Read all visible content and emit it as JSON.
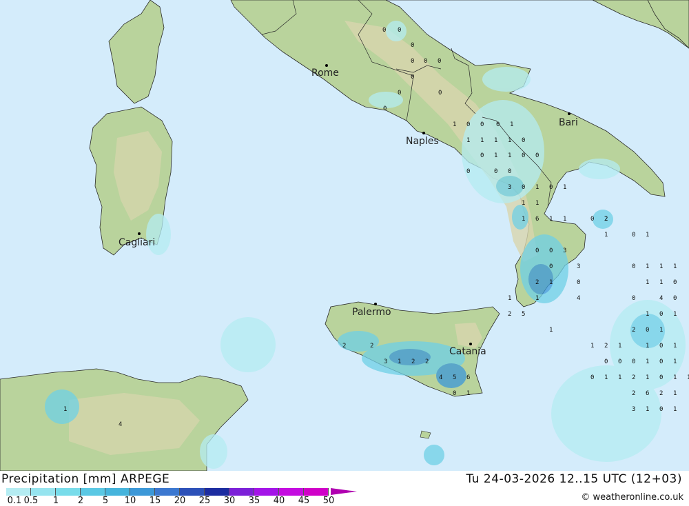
{
  "map": {
    "colors": {
      "sea": "#d4ecfb",
      "land_low": "#b9d39c",
      "land_high": "#d8d6ae",
      "precip_light": "#b4ecf2",
      "precip_mid": "#6fd0e6",
      "precip_heavy": "#3c98d8"
    },
    "cities": [
      {
        "name": "Rome"
      },
      {
        "name": "Naples"
      },
      {
        "name": "Bari"
      },
      {
        "name": "Cagliari"
      },
      {
        "name": "Palermo"
      },
      {
        "name": "Catania"
      }
    ],
    "values": [
      "0",
      "0",
      "0",
      "0",
      "0",
      "0",
      "0",
      "0",
      "0",
      "0",
      "1",
      "0",
      "0",
      "0",
      "1",
      "1",
      "1",
      "1",
      "1",
      "0",
      "0",
      "1",
      "1",
      "0",
      "0",
      "0",
      "0",
      "0",
      "3",
      "0",
      "1",
      "0",
      "1",
      "1",
      "1",
      "1",
      "6",
      "1",
      "1",
      "0",
      "2",
      "0",
      "0",
      "0",
      "3",
      "2",
      "1",
      "0",
      "3",
      "4",
      "1",
      "1",
      "2",
      "5",
      "1",
      "0",
      "1",
      "1",
      "0",
      "1",
      "0",
      "1",
      "0",
      "1",
      "1",
      "4",
      "2",
      "2",
      "3",
      "1",
      "2",
      "2",
      "4",
      "5",
      "6",
      "0",
      "1",
      "2",
      "6",
      "2",
      "1",
      "3",
      "1",
      "0",
      "1",
      "2",
      "1",
      "0",
      "1",
      "0",
      "1",
      "2",
      "1",
      "4",
      "0",
      "0",
      "1",
      "1",
      "0",
      "0",
      "1",
      "1",
      "1",
      "1",
      "2",
      "1",
      "0",
      "0",
      "0",
      "1",
      "1",
      "2",
      "1",
      "0",
      "1",
      "1"
    ]
  },
  "footer": {
    "title": "Precipitation [mm] ARPEGE",
    "run_time": "Tu 24-03-2026 12..15 UTC (12+03)",
    "credit": "© weatheronline.co.uk",
    "legend": {
      "labels": [
        "0.1",
        "0.5",
        "1",
        "2",
        "5",
        "10",
        "15",
        "20",
        "25",
        "30",
        "35",
        "40",
        "45",
        "50"
      ],
      "colors": [
        "#b4ecf2",
        "#96e4ef",
        "#78dcea",
        "#5ac8e4",
        "#46b4dc",
        "#3c98d8",
        "#3c78d0",
        "#2c50b8",
        "#1c2ca0",
        "#7c20d8",
        "#a414e8",
        "#c40ce0",
        "#d000c8",
        "#b000b0"
      ]
    }
  }
}
